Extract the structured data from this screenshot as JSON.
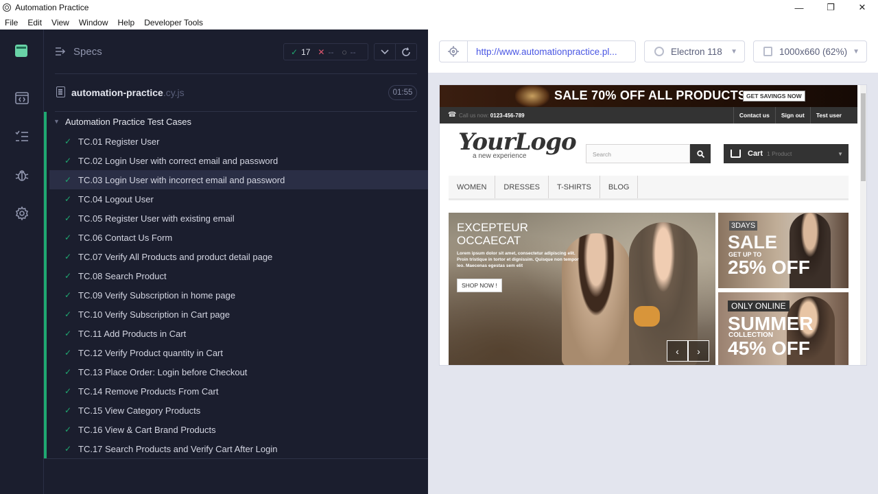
{
  "window": {
    "title": "Automation Practice",
    "controls": {
      "minimize": "—",
      "maximize": "❐",
      "close": "✕"
    }
  },
  "menubar": [
    "File",
    "Edit",
    "View",
    "Window",
    "Help",
    "Developer Tools"
  ],
  "leftnav": {
    "items": [
      "specs-list-icon",
      "runs-icon",
      "debug-bug-icon",
      "settings-gear-icon"
    ]
  },
  "specs_panel": {
    "header_label": "Specs",
    "stats": {
      "passed": "17",
      "failed": "--",
      "pending": "--"
    },
    "file": {
      "name": "automation-practice",
      "ext": ".cy.js",
      "duration": "01:55"
    },
    "suite_title": "Automation Practice Test Cases",
    "tests": [
      "TC.01 Register User",
      "TC.02 Login User with correct email and password",
      "TC.03 Login User with incorrect email and password",
      "TC.04 Logout User",
      "TC.05 Register User with existing email",
      "TC.06 Contact Us Form",
      "TC.07 Verify All Products and product detail page",
      "TC.08 Search Product",
      "TC.09 Verify Subscription in home page",
      "TC.10 Verify Subscription in Cart page",
      "TC.11 Add Products in Cart",
      "TC.12 Verify Product quantity in Cart",
      "TC.13 Place Order: Login before Checkout",
      "TC.14 Remove Products From Cart",
      "TC.15 View Category Products",
      "TC.16 View & Cart Brand Products",
      "TC.17 Search Products and Verify Cart After Login"
    ],
    "highlighted_test_index": 2
  },
  "aut_toolbar": {
    "url": "http://www.automationpractice.pl...",
    "browser": "Electron 118",
    "viewport_size": "1000x660 (62%)"
  },
  "site": {
    "promo_text": "SALE 70% OFF ALL PRODUCTS",
    "promo_button": "GET SAVINGS NOW",
    "call_us": "Call us now: ",
    "phone": "0123-456-789",
    "top_links": [
      "Contact us",
      "Sign out",
      "Test user"
    ],
    "logo_main": "YourLogo",
    "logo_sub": "a new experience",
    "search_placeholder": "Search",
    "cart_label": "Cart",
    "cart_qty": "1 Product",
    "nav": [
      "WOMEN",
      "DRESSES",
      "T-SHIRTS",
      "BLOG"
    ],
    "hero": {
      "title_line1": "EXCEPTEUR",
      "title_line2": "OCCAECAT",
      "body": "Lorem ipsum dolor sit amet, consectetur adipiscing elit. Proin tristique in tortor et dignissim. Quisque non tempor leo. Maecenas egestas sem elit",
      "button": "SHOP NOW !"
    },
    "banner1": {
      "tag": "3DAYS",
      "big": "SALE",
      "small": "GET UP TO",
      "off": "25% OFF"
    },
    "banner2": {
      "tag": "ONLY ONLINE",
      "big": "SUMMER",
      "small": "COLLECTION",
      "off": "45% OFF"
    }
  },
  "colors": {
    "sidebar_bg": "#1b1e2e",
    "pass_green": "#1fa971",
    "fail_red": "#e45770",
    "url_blue": "#4956e3",
    "aut_bg": "#e3e5ee"
  }
}
